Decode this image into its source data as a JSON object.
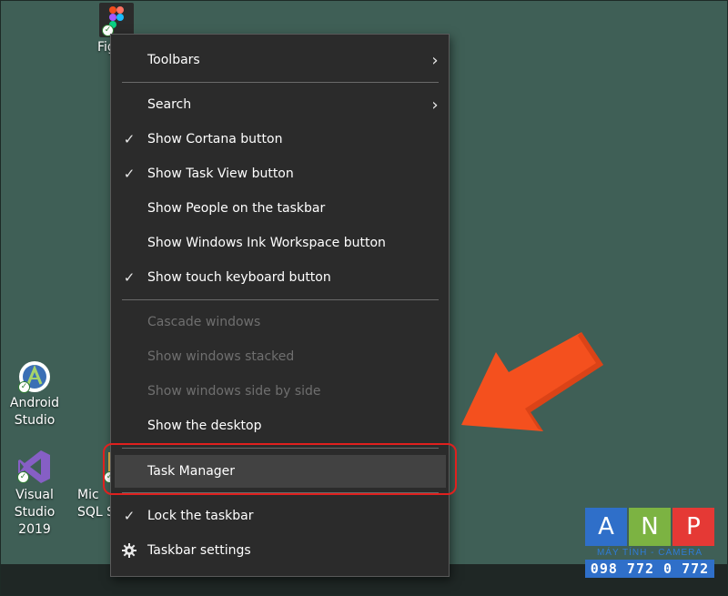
{
  "desktop": {
    "figma_label": "Fig",
    "android_studio_label": "Android\nStudio",
    "visual_studio_label": "Visual Studio\n2019",
    "sql_label": "Mic\nSQL S"
  },
  "menu": {
    "items": [
      {
        "label": "Toolbars",
        "check": false,
        "submenu": true,
        "disabled": false
      },
      {
        "label": "Search",
        "check": false,
        "submenu": true,
        "disabled": false
      },
      {
        "label": "Show Cortana button",
        "check": true,
        "submenu": false,
        "disabled": false
      },
      {
        "label": "Show Task View button",
        "check": true,
        "submenu": false,
        "disabled": false
      },
      {
        "label": "Show People on the taskbar",
        "check": false,
        "submenu": false,
        "disabled": false
      },
      {
        "label": "Show Windows Ink Workspace button",
        "check": false,
        "submenu": false,
        "disabled": false
      },
      {
        "label": "Show touch keyboard button",
        "check": true,
        "submenu": false,
        "disabled": false
      },
      {
        "label": "Cascade windows",
        "check": false,
        "submenu": false,
        "disabled": true
      },
      {
        "label": "Show windows stacked",
        "check": false,
        "submenu": false,
        "disabled": true
      },
      {
        "label": "Show windows side by side",
        "check": false,
        "submenu": false,
        "disabled": true
      },
      {
        "label": "Show the desktop",
        "check": false,
        "submenu": false,
        "disabled": false
      },
      {
        "label": "Task Manager",
        "check": false,
        "submenu": false,
        "disabled": false,
        "highlighted": true
      },
      {
        "label": "Lock the taskbar",
        "check": true,
        "submenu": false,
        "disabled": false
      },
      {
        "label": "Taskbar settings",
        "check": false,
        "submenu": false,
        "disabled": false,
        "icon": "gear-icon"
      }
    ],
    "check_glyph": "✓",
    "chevron_glyph": "›"
  },
  "logo": {
    "letters": [
      "A",
      "N",
      "P"
    ],
    "colors": [
      "#2f6fc9",
      "#7cb342",
      "#e53935"
    ],
    "tagline": "MÁY TÍNH - CAMERA",
    "phone": "098 772 0 772"
  },
  "colors": {
    "desktop": "#3f5f56",
    "menu_bg": "#2b2b2b",
    "highlight": "#424242",
    "callout": "#e0201e",
    "arrow": "#f4501e"
  }
}
